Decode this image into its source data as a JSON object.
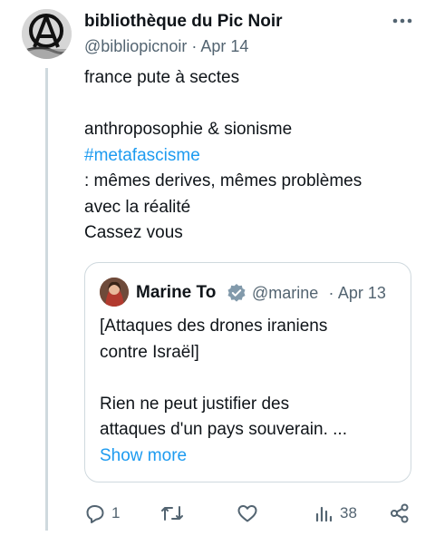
{
  "tweet": {
    "author_name": "bibliothèque du Pic Noir",
    "handle": "@bibliopicnoir",
    "separator": "·",
    "date": "Apr 14",
    "lines": [
      "france pute à sectes",
      "",
      "anthroposophie & sionisme",
      "",
      " : mêmes derives, mêmes problèmes",
      "avec la réalité",
      "Cassez vous"
    ],
    "hashtag": "#metafascisme"
  },
  "quote": {
    "author_name": "Marine To",
    "handle": "@marine",
    "separator": "·",
    "date": "Apr 13",
    "lines": [
      "[Attaques des drones iraniens",
      "contre Israël]",
      "",
      "Rien ne peut justifier des",
      "attaques d'un pays souverain. ..."
    ],
    "show_more": "Show more"
  },
  "actions": {
    "reply_count": "1",
    "retweet_count": "",
    "like_count": "",
    "views_count": "38"
  },
  "icons": {
    "more": "more-horizontal-icon",
    "reply": "reply-icon",
    "retweet": "retweet-icon",
    "like": "heart-icon",
    "views": "bar-chart-icon",
    "share": "share-icon",
    "verified": "verified-badge-icon"
  },
  "colors": {
    "link": "#1d9bf0",
    "secondary_text": "#536471",
    "border": "#cfd9de"
  }
}
